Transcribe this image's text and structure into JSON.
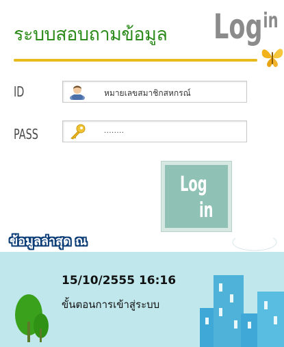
{
  "header": {
    "title": "ระบบสอบถามข้อมูล",
    "brand": "Log",
    "brand_sup": "in"
  },
  "form": {
    "id_label": "ID",
    "id_value": "หมายเลขสมาชิกสหกรณ์",
    "pass_label": "PASS",
    "pass_value": "........",
    "login_button_line1": "Log",
    "login_button_line2": "in"
  },
  "latest": {
    "header": "ข้อมูลล่าสุด ณ",
    "date": "15/10/2555 16:16",
    "steps_link": "ขั้นตอนการเข้าสู่ระบบ"
  },
  "colors": {
    "title_green": "#2d8c1c",
    "rule_gold": "#e6b91c",
    "button_teal": "#8fc1b5",
    "info_sky": "#bfe7ec",
    "building_blue": "#4fb3d9",
    "tree_green": "#3aa11c"
  },
  "icons": {
    "id_field": "user-icon",
    "pass_field": "key-icon",
    "decoration": "butterfly-icon"
  }
}
